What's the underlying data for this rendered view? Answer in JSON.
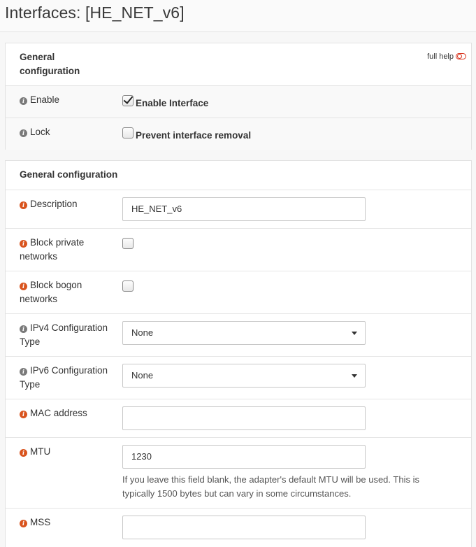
{
  "page": {
    "title": "Interfaces: [HE_NET_v6]"
  },
  "panel1": {
    "title": "General configuration",
    "full_help": "full help",
    "enable": {
      "label": "Enable",
      "checkbox_label": "Enable Interface",
      "checked": true
    },
    "lock": {
      "label": "Lock",
      "checkbox_label": "Prevent interface removal",
      "checked": false
    }
  },
  "panel2": {
    "title": "General configuration",
    "description": {
      "label": "Description",
      "value": "HE_NET_v6"
    },
    "block_private": {
      "label": "Block private networks",
      "checked": false
    },
    "block_bogon": {
      "label": "Block bogon networks",
      "checked": false
    },
    "ipv4_type": {
      "label": "IPv4 Configuration Type",
      "value": "None"
    },
    "ipv6_type": {
      "label": "IPv6 Configuration Type",
      "value": "None"
    },
    "mac": {
      "label": "MAC address",
      "value": ""
    },
    "mtu": {
      "label": "MTU",
      "value": "1230",
      "help": "If you leave this field blank, the adapter's default MTU will be used. This is typically 1500 bytes but can vary in some circumstances."
    },
    "mss": {
      "label": "MSS",
      "value": ""
    }
  },
  "colors": {
    "info_icon_orange": "#d9541e",
    "info_icon_grey": "#7a7a7a",
    "toggle_red": "#d9341e"
  }
}
